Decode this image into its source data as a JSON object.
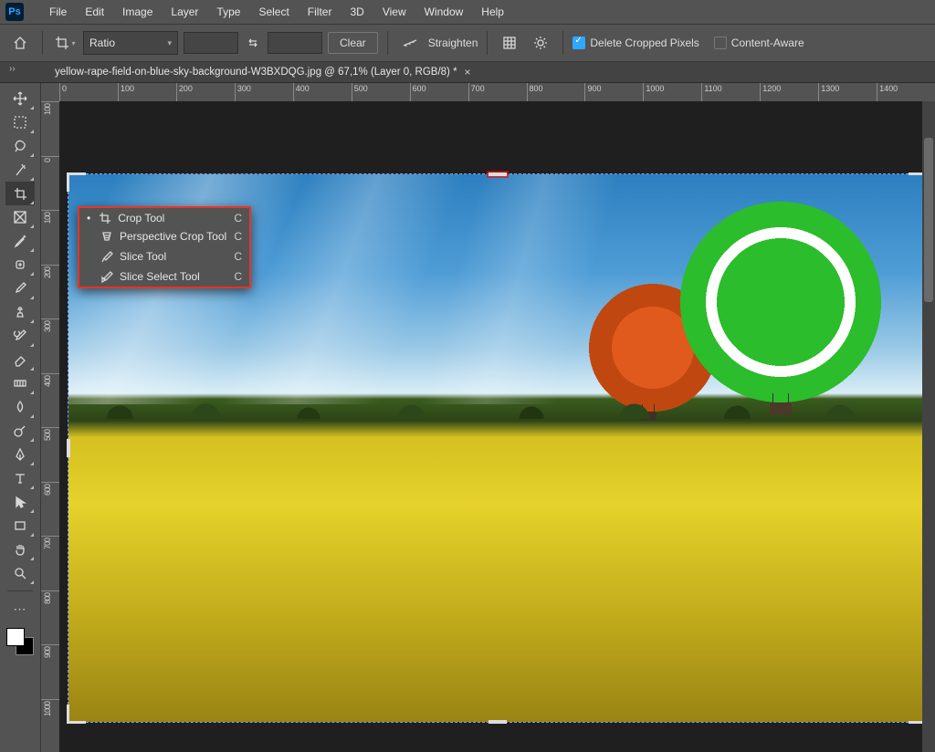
{
  "menubar": [
    "File",
    "Edit",
    "Image",
    "Layer",
    "Type",
    "Select",
    "Filter",
    "3D",
    "View",
    "Window",
    "Help"
  ],
  "options": {
    "ratio_label": "Ratio",
    "clear": "Clear",
    "straighten": "Straighten",
    "delete_cropped": "Delete Cropped Pixels",
    "content_aware": "Content-Aware"
  },
  "document_tab": "yellow-rape-field-on-blue-sky-background-W3BXDQG.jpg @ 67,1% (Layer 0, RGB/8) *",
  "ruler_h": [
    "0",
    "100",
    "200",
    "300",
    "400",
    "500",
    "600",
    "700",
    "800",
    "900",
    "1000",
    "1100",
    "1200",
    "1300",
    "1400"
  ],
  "ruler_v": [
    "100",
    "0",
    "100",
    "200",
    "300",
    "400",
    "500",
    "600",
    "700",
    "800",
    "900",
    "1000"
  ],
  "tools": [
    {
      "name": "move-tool"
    },
    {
      "name": "marquee-tool"
    },
    {
      "name": "lasso-tool"
    },
    {
      "name": "magic-wand-tool"
    },
    {
      "name": "crop-tool",
      "active": true
    },
    {
      "name": "frame-tool"
    },
    {
      "name": "eyedropper-tool"
    },
    {
      "name": "healing-brush-tool"
    },
    {
      "name": "brush-tool"
    },
    {
      "name": "clone-stamp-tool"
    },
    {
      "name": "history-brush-tool"
    },
    {
      "name": "eraser-tool"
    },
    {
      "name": "gradient-tool"
    },
    {
      "name": "blur-tool"
    },
    {
      "name": "dodge-tool"
    },
    {
      "name": "pen-tool"
    },
    {
      "name": "type-tool"
    },
    {
      "name": "path-selection-tool"
    },
    {
      "name": "rectangle-tool"
    },
    {
      "name": "hand-tool"
    },
    {
      "name": "zoom-tool"
    }
  ],
  "flyout": [
    {
      "label": "Crop Tool",
      "shortcut": "C",
      "selected": true,
      "icon": "crop"
    },
    {
      "label": "Perspective Crop Tool",
      "shortcut": "C",
      "icon": "perspective-crop"
    },
    {
      "label": "Slice Tool",
      "shortcut": "C",
      "icon": "slice"
    },
    {
      "label": "Slice Select Tool",
      "shortcut": "C",
      "icon": "slice-select"
    }
  ]
}
